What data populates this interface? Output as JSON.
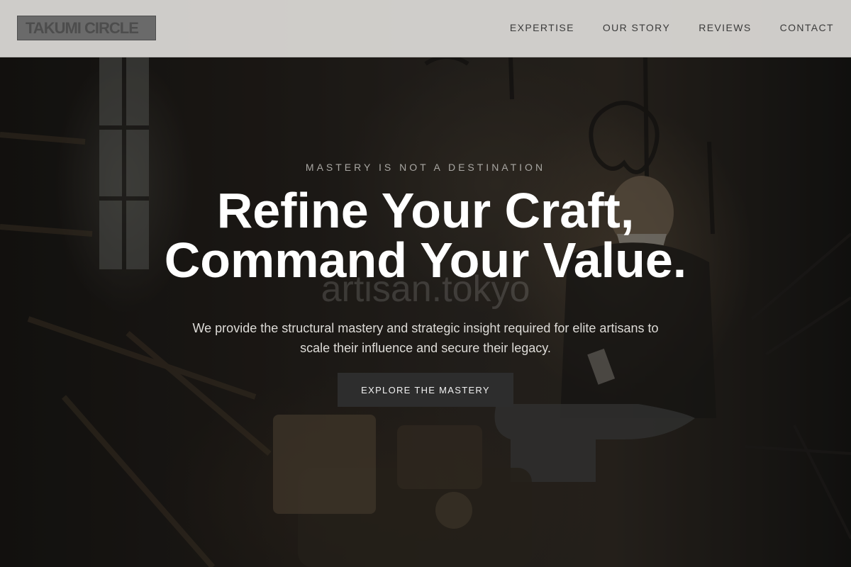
{
  "header": {
    "logo_text": "TAKUMI CIRCLE",
    "nav": [
      {
        "label": "EXPERTISE"
      },
      {
        "label": "OUR STORY"
      },
      {
        "label": "REVIEWS"
      },
      {
        "label": "CONTACT"
      }
    ]
  },
  "hero": {
    "eyebrow": "MASTERY IS NOT A DESTINATION",
    "headline_line1": "Refine Your Craft,",
    "headline_line2": "Command Your Value.",
    "watermark": "artisan.tokyo",
    "subtext": "We provide the structural mastery and strategic insight required for elite artisans to scale their influence and secure their legacy.",
    "cta_label": "EXPLORE THE MASTERY"
  },
  "colors": {
    "header_bg": "#d6d4d1",
    "cta_bg": "#2d2d2d",
    "headline": "#ffffff"
  }
}
